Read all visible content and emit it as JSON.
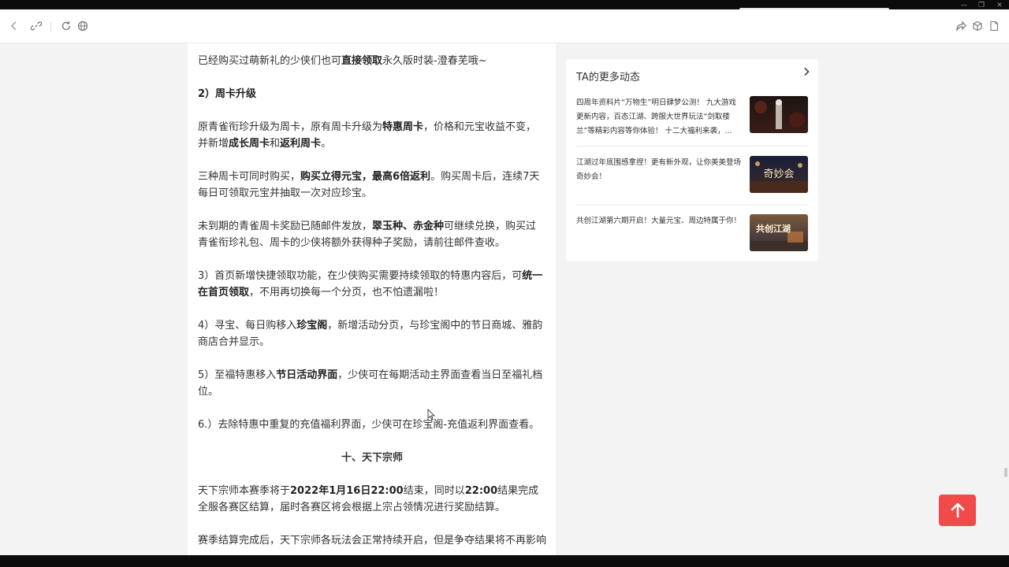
{
  "article": {
    "p1_a": "已经购买过萌新礼的少侠们也可",
    "p1_b": "直接领取",
    "p1_c": "永久版时装-澄春芜哦~",
    "h_weekcard": "2）周卡升级",
    "p2_a": "原青雀衔珍升级为周卡，原有周卡升级为",
    "p2_b": "特惠周卡",
    "p2_c": "，价格和元宝收益不变，并新增",
    "p2_d": "成长周卡",
    "p2_e": "和",
    "p2_f": "返利周卡",
    "p2_g": "。",
    "p3_a": "三种周卡可同时购买，",
    "p3_b": "购买立得元宝，最高6倍返利",
    "p3_c": "。购买周卡后，连续7天每日可领取元宝并抽取一次对应珍宝。",
    "p4_a": "未到期的青雀周卡奖励已随邮件发放，",
    "p4_b": "翠玉种、赤金种",
    "p4_c": "可继续兑换，购买过青雀衔珍礼包、周卡的少侠将额外获得种子奖励，请前往邮件查收。",
    "p5_a": "3）首页新增快捷领取功能，在少侠购买需要持续领取的特惠内容后，可",
    "p5_b": "统一在首页领取",
    "p5_c": "，不用再切换每一个分页，也不怕遗漏啦！",
    "p6_a": "4）寻宝、每日购移入",
    "p6_b": "珍宝阁",
    "p6_c": "，新增活动分页，与珍宝阁中的节日商城、雅韵商店合并显示。",
    "p7_a": "5）至福特惠移入",
    "p7_b": "节日活动界面",
    "p7_c": "，少侠可在每期活动主界面查看当日至福礼档位。",
    "p8": "6.）去除特惠中重复的充值福利界面，少侠可在珍宝阁-充值返利界面查看。",
    "h_section": "十、天下宗师",
    "p9_a": "天下宗师本赛季将于",
    "p9_b": "2022年1月16日22:00",
    "p9_c": "结束，同时以",
    "p9_d": "22:00",
    "p9_e": "结果完成全服各赛区结算，届时各赛区将会根据上宗占领情况进行奖励结算。",
    "p10": "赛季结算完成后，天下宗师各玩法会正常持续开启，但是争夺结果将不再影响"
  },
  "sidebar": {
    "title": "TA的更多动态",
    "items": [
      {
        "text": "四周年资料片“万物生”明日肆梦公测！ 九大游戏更新内容，百态江湖、跨服大世界玩法“剑取楼兰”等精彩内容等你体验！ 十二大福利来袭，..."
      },
      {
        "text": "江湖过年底围感拿捏！更有新外观，让你美美登场奇妙会！",
        "thumb_text": "奇妙会"
      },
      {
        "text": "共创江湖第六期开启！大量元宝、周边特属于你！",
        "thumb_text": "共创江湖"
      }
    ]
  },
  "colors": {
    "accent": "#f04a4a",
    "page_bg": "#f3f3f3"
  }
}
